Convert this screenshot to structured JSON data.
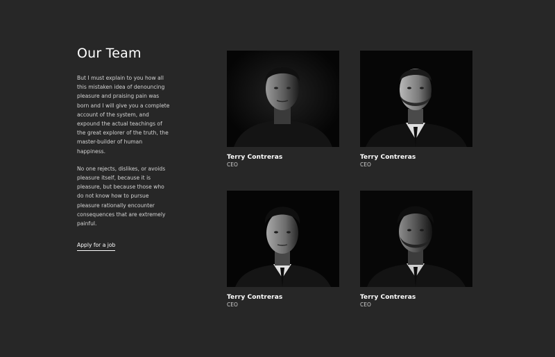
{
  "section": {
    "title": "Our Team",
    "paragraphs": [
      "But I must explain to you how all this mistaken idea of denouncing pleasure and praising pain was born and I will give you a complete account of the system, and expound the actual teachings of the great explorer of the truth, the master-builder of human happiness.",
      "No one rejects, dislikes, or avoids pleasure itself, because it is pleasure, but because those who do not know how to pursue pleasure rationally encounter consequences that are extremely painful."
    ],
    "cta_label": "Apply for a job"
  },
  "team": [
    {
      "name": "Terry Contreras",
      "role": "CEO"
    },
    {
      "name": "Terry Contreras",
      "role": "CEO"
    },
    {
      "name": "Terry Contreras",
      "role": "CEO"
    },
    {
      "name": "Terry Contreras",
      "role": "CEO"
    }
  ],
  "colors": {
    "background": "#272727",
    "photo_background": "#070707",
    "text_primary": "#ffffff",
    "text_secondary": "#d4d4d4"
  }
}
